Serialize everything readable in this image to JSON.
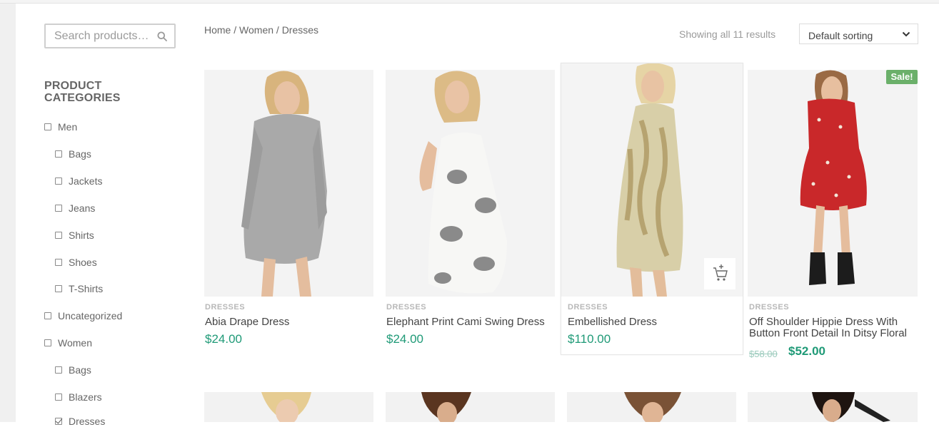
{
  "search": {
    "placeholder": "Search products…"
  },
  "sidebar": {
    "title": "PRODUCT CATEGORIES",
    "items": [
      {
        "label": "Men",
        "checked": false
      },
      {
        "label": "Bags",
        "checked": false
      },
      {
        "label": "Jackets",
        "checked": false
      },
      {
        "label": "Jeans",
        "checked": false
      },
      {
        "label": "Shirts",
        "checked": false
      },
      {
        "label": "Shoes",
        "checked": false
      },
      {
        "label": "T-Shirts",
        "checked": false
      },
      {
        "label": "Uncategorized",
        "checked": false
      },
      {
        "label": "Women",
        "checked": false
      },
      {
        "label": "Bags",
        "checked": false
      },
      {
        "label": "Blazers",
        "checked": false
      },
      {
        "label": "Dresses",
        "checked": true
      }
    ]
  },
  "breadcrumb": {
    "home": "Home",
    "sep": " / ",
    "women": "Women",
    "current": "Dresses"
  },
  "results_text": "Showing all 11 results",
  "sorting": {
    "selected": "Default sorting"
  },
  "products": [
    {
      "category": "DRESSES",
      "name": "Abia Drape Dress",
      "price": "$24.00"
    },
    {
      "category": "DRESSES",
      "name": "Elephant Print Cami Swing Dress",
      "price": "$24.00"
    },
    {
      "category": "DRESSES",
      "name": "Embellished Dress",
      "price": "$110.00"
    },
    {
      "category": "DRESSES",
      "name": "Off Shoulder Hippie Dress With Button Front Detail In Ditsy Floral",
      "old_price": "$58.00",
      "price": "$52.00",
      "badge": "Sale!"
    }
  ],
  "colors": {
    "accent_green": "#1f9a77",
    "sale_badge": "#6bb06a"
  },
  "icons": {
    "search": "search-icon",
    "sort": "chevron-down-icon",
    "cart": "add-to-cart-icon"
  }
}
